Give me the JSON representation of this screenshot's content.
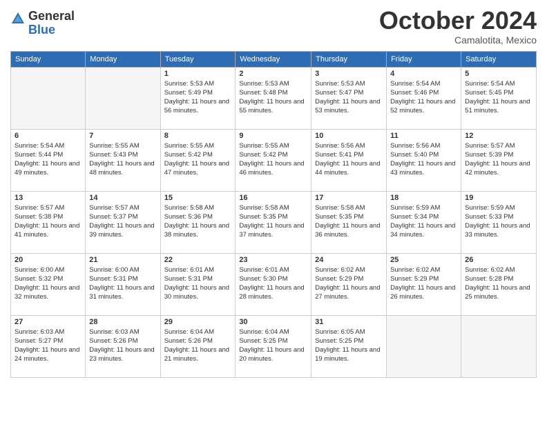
{
  "header": {
    "logo_general": "General",
    "logo_blue": "Blue",
    "month_title": "October 2024",
    "location": "Camalotita, Mexico"
  },
  "weekdays": [
    "Sunday",
    "Monday",
    "Tuesday",
    "Wednesday",
    "Thursday",
    "Friday",
    "Saturday"
  ],
  "weeks": [
    [
      {
        "day": "",
        "sunrise": "",
        "sunset": "",
        "daylight": ""
      },
      {
        "day": "",
        "sunrise": "",
        "sunset": "",
        "daylight": ""
      },
      {
        "day": "1",
        "sunrise": "Sunrise: 5:53 AM",
        "sunset": "Sunset: 5:49 PM",
        "daylight": "Daylight: 11 hours and 56 minutes."
      },
      {
        "day": "2",
        "sunrise": "Sunrise: 5:53 AM",
        "sunset": "Sunset: 5:48 PM",
        "daylight": "Daylight: 11 hours and 55 minutes."
      },
      {
        "day": "3",
        "sunrise": "Sunrise: 5:53 AM",
        "sunset": "Sunset: 5:47 PM",
        "daylight": "Daylight: 11 hours and 53 minutes."
      },
      {
        "day": "4",
        "sunrise": "Sunrise: 5:54 AM",
        "sunset": "Sunset: 5:46 PM",
        "daylight": "Daylight: 11 hours and 52 minutes."
      },
      {
        "day": "5",
        "sunrise": "Sunrise: 5:54 AM",
        "sunset": "Sunset: 5:45 PM",
        "daylight": "Daylight: 11 hours and 51 minutes."
      }
    ],
    [
      {
        "day": "6",
        "sunrise": "Sunrise: 5:54 AM",
        "sunset": "Sunset: 5:44 PM",
        "daylight": "Daylight: 11 hours and 49 minutes."
      },
      {
        "day": "7",
        "sunrise": "Sunrise: 5:55 AM",
        "sunset": "Sunset: 5:43 PM",
        "daylight": "Daylight: 11 hours and 48 minutes."
      },
      {
        "day": "8",
        "sunrise": "Sunrise: 5:55 AM",
        "sunset": "Sunset: 5:42 PM",
        "daylight": "Daylight: 11 hours and 47 minutes."
      },
      {
        "day": "9",
        "sunrise": "Sunrise: 5:55 AM",
        "sunset": "Sunset: 5:42 PM",
        "daylight": "Daylight: 11 hours and 46 minutes."
      },
      {
        "day": "10",
        "sunrise": "Sunrise: 5:56 AM",
        "sunset": "Sunset: 5:41 PM",
        "daylight": "Daylight: 11 hours and 44 minutes."
      },
      {
        "day": "11",
        "sunrise": "Sunrise: 5:56 AM",
        "sunset": "Sunset: 5:40 PM",
        "daylight": "Daylight: 11 hours and 43 minutes."
      },
      {
        "day": "12",
        "sunrise": "Sunrise: 5:57 AM",
        "sunset": "Sunset: 5:39 PM",
        "daylight": "Daylight: 11 hours and 42 minutes."
      }
    ],
    [
      {
        "day": "13",
        "sunrise": "Sunrise: 5:57 AM",
        "sunset": "Sunset: 5:38 PM",
        "daylight": "Daylight: 11 hours and 41 minutes."
      },
      {
        "day": "14",
        "sunrise": "Sunrise: 5:57 AM",
        "sunset": "Sunset: 5:37 PM",
        "daylight": "Daylight: 11 hours and 39 minutes."
      },
      {
        "day": "15",
        "sunrise": "Sunrise: 5:58 AM",
        "sunset": "Sunset: 5:36 PM",
        "daylight": "Daylight: 11 hours and 38 minutes."
      },
      {
        "day": "16",
        "sunrise": "Sunrise: 5:58 AM",
        "sunset": "Sunset: 5:35 PM",
        "daylight": "Daylight: 11 hours and 37 minutes."
      },
      {
        "day": "17",
        "sunrise": "Sunrise: 5:58 AM",
        "sunset": "Sunset: 5:35 PM",
        "daylight": "Daylight: 11 hours and 36 minutes."
      },
      {
        "day": "18",
        "sunrise": "Sunrise: 5:59 AM",
        "sunset": "Sunset: 5:34 PM",
        "daylight": "Daylight: 11 hours and 34 minutes."
      },
      {
        "day": "19",
        "sunrise": "Sunrise: 5:59 AM",
        "sunset": "Sunset: 5:33 PM",
        "daylight": "Daylight: 11 hours and 33 minutes."
      }
    ],
    [
      {
        "day": "20",
        "sunrise": "Sunrise: 6:00 AM",
        "sunset": "Sunset: 5:32 PM",
        "daylight": "Daylight: 11 hours and 32 minutes."
      },
      {
        "day": "21",
        "sunrise": "Sunrise: 6:00 AM",
        "sunset": "Sunset: 5:31 PM",
        "daylight": "Daylight: 11 hours and 31 minutes."
      },
      {
        "day": "22",
        "sunrise": "Sunrise: 6:01 AM",
        "sunset": "Sunset: 5:31 PM",
        "daylight": "Daylight: 11 hours and 30 minutes."
      },
      {
        "day": "23",
        "sunrise": "Sunrise: 6:01 AM",
        "sunset": "Sunset: 5:30 PM",
        "daylight": "Daylight: 11 hours and 28 minutes."
      },
      {
        "day": "24",
        "sunrise": "Sunrise: 6:02 AM",
        "sunset": "Sunset: 5:29 PM",
        "daylight": "Daylight: 11 hours and 27 minutes."
      },
      {
        "day": "25",
        "sunrise": "Sunrise: 6:02 AM",
        "sunset": "Sunset: 5:29 PM",
        "daylight": "Daylight: 11 hours and 26 minutes."
      },
      {
        "day": "26",
        "sunrise": "Sunrise: 6:02 AM",
        "sunset": "Sunset: 5:28 PM",
        "daylight": "Daylight: 11 hours and 25 minutes."
      }
    ],
    [
      {
        "day": "27",
        "sunrise": "Sunrise: 6:03 AM",
        "sunset": "Sunset: 5:27 PM",
        "daylight": "Daylight: 11 hours and 24 minutes."
      },
      {
        "day": "28",
        "sunrise": "Sunrise: 6:03 AM",
        "sunset": "Sunset: 5:26 PM",
        "daylight": "Daylight: 11 hours and 23 minutes."
      },
      {
        "day": "29",
        "sunrise": "Sunrise: 6:04 AM",
        "sunset": "Sunset: 5:26 PM",
        "daylight": "Daylight: 11 hours and 21 minutes."
      },
      {
        "day": "30",
        "sunrise": "Sunrise: 6:04 AM",
        "sunset": "Sunset: 5:25 PM",
        "daylight": "Daylight: 11 hours and 20 minutes."
      },
      {
        "day": "31",
        "sunrise": "Sunrise: 6:05 AM",
        "sunset": "Sunset: 5:25 PM",
        "daylight": "Daylight: 11 hours and 19 minutes."
      },
      {
        "day": "",
        "sunrise": "",
        "sunset": "",
        "daylight": ""
      },
      {
        "day": "",
        "sunrise": "",
        "sunset": "",
        "daylight": ""
      }
    ]
  ]
}
